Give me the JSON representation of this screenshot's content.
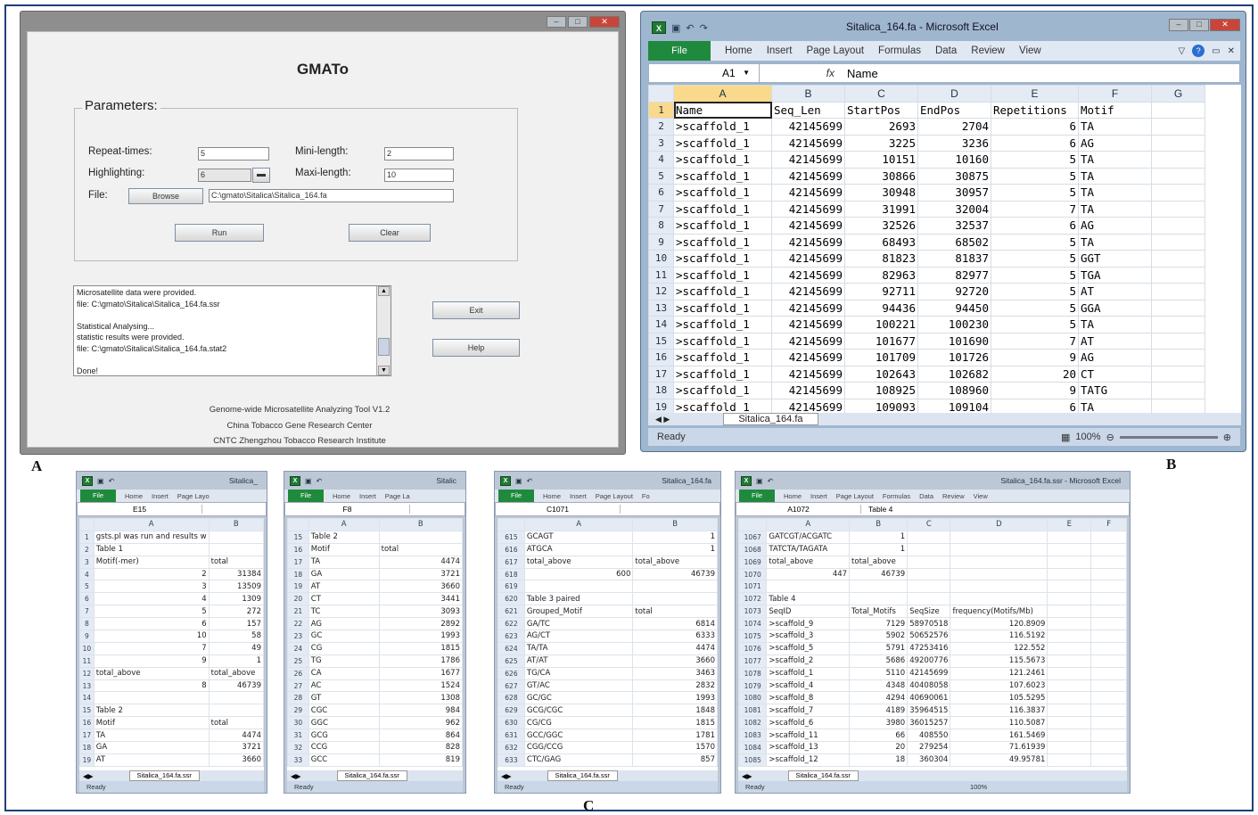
{
  "letters": {
    "a": "A",
    "b": "B",
    "c": "C"
  },
  "gmato": {
    "title": "GMATo",
    "params_legend": "Parameters:",
    "repeat_label": "Repeat-times:",
    "repeat_value": "5",
    "minilen_label": "Mini-length:",
    "minilen_value": "2",
    "highlight_label": "Highlighting:",
    "highlight_value": "6",
    "maxlen_label": "Maxi-length:",
    "maxlen_value": "10",
    "file_label": "File:",
    "browse_label": "Browse",
    "file_path": "C:\\gmato\\Sitalica\\Sitalica_164.fa",
    "run_label": "Run",
    "clear_label": "Clear",
    "log_lines": [
      "Microsatellite data were provided.",
      "file:  C:\\gmato\\Sitalica\\Sitalica_164.fa.ssr",
      "",
      "Statistical Analysing...",
      "statistic results were provided.",
      "file:  C:\\gmato\\Sitalica\\Sitalica_164.fa.stat2",
      "",
      "Done!"
    ],
    "exit_label": "Exit",
    "help_label": "Help",
    "footer": [
      "Genome-wide Microsatellite Analyzing Tool V1.2",
      "China Tobacco Gene Research Center",
      "CNTC Zhengzhou Tobacco Research Institute"
    ]
  },
  "excel": {
    "title": "Sitalica_164.fa - Microsoft Excel",
    "file_tab": "File",
    "menu": [
      "Home",
      "Insert",
      "Page Layout",
      "Formulas",
      "Data",
      "Review",
      "View"
    ],
    "name_box": "A1",
    "fx": "fx",
    "formula_value": "Name",
    "col_headers": [
      "A",
      "B",
      "C",
      "D",
      "E",
      "F",
      "G"
    ],
    "rows": [
      [
        "1",
        "Name",
        "Seq_Len",
        "StartPos",
        "EndPos",
        "Repetitions",
        "Motif"
      ],
      [
        "2",
        ">scaffold_1",
        "42145699",
        "2693",
        "2704",
        "6",
        "TA"
      ],
      [
        "3",
        ">scaffold_1",
        "42145699",
        "3225",
        "3236",
        "6",
        "AG"
      ],
      [
        "4",
        ">scaffold_1",
        "42145699",
        "10151",
        "10160",
        "5",
        "TA"
      ],
      [
        "5",
        ">scaffold_1",
        "42145699",
        "30866",
        "30875",
        "5",
        "TA"
      ],
      [
        "6",
        ">scaffold_1",
        "42145699",
        "30948",
        "30957",
        "5",
        "TA"
      ],
      [
        "7",
        ">scaffold_1",
        "42145699",
        "31991",
        "32004",
        "7",
        "TA"
      ],
      [
        "8",
        ">scaffold_1",
        "42145699",
        "32526",
        "32537",
        "6",
        "AG"
      ],
      [
        "9",
        ">scaffold_1",
        "42145699",
        "68493",
        "68502",
        "5",
        "TA"
      ],
      [
        "10",
        ">scaffold_1",
        "42145699",
        "81823",
        "81837",
        "5",
        "GGT"
      ],
      [
        "11",
        ">scaffold_1",
        "42145699",
        "82963",
        "82977",
        "5",
        "TGA"
      ],
      [
        "12",
        ">scaffold_1",
        "42145699",
        "92711",
        "92720",
        "5",
        "AT"
      ],
      [
        "13",
        ">scaffold_1",
        "42145699",
        "94436",
        "94450",
        "5",
        "GGA"
      ],
      [
        "14",
        ">scaffold_1",
        "42145699",
        "100221",
        "100230",
        "5",
        "TA"
      ],
      [
        "15",
        ">scaffold_1",
        "42145699",
        "101677",
        "101690",
        "7",
        "AT"
      ],
      [
        "16",
        ">scaffold_1",
        "42145699",
        "101709",
        "101726",
        "9",
        "AG"
      ],
      [
        "17",
        ">scaffold_1",
        "42145699",
        "102643",
        "102682",
        "20",
        "CT"
      ],
      [
        "18",
        ">scaffold_1",
        "42145699",
        "108925",
        "108960",
        "9",
        "TATG"
      ],
      [
        "19",
        ">scaffold_1",
        "42145699",
        "109093",
        "109104",
        "6",
        "TA"
      ]
    ],
    "sheet_tab": "Sitalica_164.fa",
    "status": "Ready",
    "zoom": "100%"
  },
  "small": [
    {
      "title": "Sitalica_",
      "name_box": "E15",
      "formula_value": "",
      "file_tab": "File",
      "menu": [
        "Home",
        "Insert",
        "Page Layo"
      ],
      "cols": [
        "A",
        "B"
      ],
      "rows": [
        [
          "1",
          "gsts.pl was run and results w",
          ""
        ],
        [
          "2",
          "Table 1",
          ""
        ],
        [
          "3",
          "Motif(-mer)",
          "total"
        ],
        [
          "4",
          "2",
          "31384"
        ],
        [
          "5",
          "3",
          "13509"
        ],
        [
          "6",
          "4",
          "1309"
        ],
        [
          "7",
          "5",
          "272"
        ],
        [
          "8",
          "6",
          "157"
        ],
        [
          "9",
          "10",
          "58"
        ],
        [
          "10",
          "7",
          "49"
        ],
        [
          "11",
          "9",
          "1"
        ],
        [
          "12",
          "total_above",
          "total_above"
        ],
        [
          "13",
          "8",
          "46739"
        ],
        [
          "14",
          "",
          ""
        ],
        [
          "15",
          "Table 2",
          ""
        ],
        [
          "16",
          "Motif",
          "total"
        ],
        [
          "17",
          "TA",
          "4474"
        ],
        [
          "18",
          "GA",
          "3721"
        ],
        [
          "19",
          "AT",
          "3660"
        ]
      ],
      "sheet_tab": "Sitalica_164.fa.ssr",
      "status": "Ready"
    },
    {
      "title": "Sitalic",
      "name_box": "F8",
      "formula_value": "",
      "file_tab": "File",
      "menu": [
        "Home",
        "Insert",
        "Page La"
      ],
      "cols": [
        "A",
        "B"
      ],
      "rows": [
        [
          "15",
          "Table 2",
          ""
        ],
        [
          "16",
          "Motif",
          "total"
        ],
        [
          "17",
          "TA",
          "4474"
        ],
        [
          "18",
          "GA",
          "3721"
        ],
        [
          "19",
          "AT",
          "3660"
        ],
        [
          "20",
          "CT",
          "3441"
        ],
        [
          "21",
          "TC",
          "3093"
        ],
        [
          "22",
          "AG",
          "2892"
        ],
        [
          "23",
          "GC",
          "1993"
        ],
        [
          "24",
          "CG",
          "1815"
        ],
        [
          "25",
          "TG",
          "1786"
        ],
        [
          "26",
          "CA",
          "1677"
        ],
        [
          "27",
          "AC",
          "1524"
        ],
        [
          "28",
          "GT",
          "1308"
        ],
        [
          "29",
          "CGC",
          "984"
        ],
        [
          "30",
          "GGC",
          "962"
        ],
        [
          "31",
          "GCG",
          "864"
        ],
        [
          "32",
          "CCG",
          "828"
        ],
        [
          "33",
          "GCC",
          "819"
        ]
      ],
      "sheet_tab": "Sitalica_164.fa.ssr",
      "status": "Ready"
    },
    {
      "title": "Sitalica_164.fa",
      "name_box": "C1071",
      "formula_value": "",
      "file_tab": "File",
      "menu": [
        "Home",
        "Insert",
        "Page Layout",
        "Fo"
      ],
      "cols": [
        "A",
        "B"
      ],
      "rows": [
        [
          "615",
          "GCAGT",
          "1"
        ],
        [
          "616",
          "ATGCA",
          "1"
        ],
        [
          "617",
          "total_above",
          "total_above"
        ],
        [
          "618",
          "600",
          "46739"
        ],
        [
          "619",
          "",
          ""
        ],
        [
          "620",
          "Table 3 paired",
          ""
        ],
        [
          "621",
          "Grouped_Motif",
          "total"
        ],
        [
          "622",
          "GA/TC",
          "6814"
        ],
        [
          "623",
          "AG/CT",
          "6333"
        ],
        [
          "624",
          "TA/TA",
          "4474"
        ],
        [
          "625",
          "AT/AT",
          "3660"
        ],
        [
          "626",
          "TG/CA",
          "3463"
        ],
        [
          "627",
          "GT/AC",
          "2832"
        ],
        [
          "628",
          "GC/GC",
          "1993"
        ],
        [
          "629",
          "GCG/CGC",
          "1848"
        ],
        [
          "630",
          "CG/CG",
          "1815"
        ],
        [
          "631",
          "GCC/GGC",
          "1781"
        ],
        [
          "632",
          "CGG/CCG",
          "1570"
        ],
        [
          "633",
          "CTC/GAG",
          "857"
        ]
      ],
      "sheet_tab": "Sitalica_164.fa.ssr",
      "status": "Ready"
    },
    {
      "title": "Sitalica_164.fa.ssr - Microsoft Excel",
      "name_box": "A1072",
      "formula_value": "Table 4",
      "file_tab": "File",
      "menu": [
        "Home",
        "Insert",
        "Page Layout",
        "Formulas",
        "Data",
        "Review",
        "View"
      ],
      "cols": [
        "A",
        "B",
        "C",
        "D",
        "E",
        "F"
      ],
      "rows": [
        [
          "1067",
          "GATCGT/ACGATC",
          "1",
          "",
          "",
          "",
          ""
        ],
        [
          "1068",
          "TATCTA/TAGATA",
          "1",
          "",
          "",
          "",
          ""
        ],
        [
          "1069",
          "total_above",
          "total_above",
          "",
          "",
          "",
          ""
        ],
        [
          "1070",
          "447",
          "46739",
          "",
          "",
          "",
          ""
        ],
        [
          "1071",
          "",
          "",
          "",
          "",
          "",
          ""
        ],
        [
          "1072",
          "Table 4",
          "",
          "",
          "",
          "",
          ""
        ],
        [
          "1073",
          "SeqID",
          "Total_Motifs",
          "SeqSize",
          "frequency(Motifs/Mb)",
          "",
          ""
        ],
        [
          "1074",
          ">scaffold_9",
          "7129",
          "58970518",
          "120.8909",
          "",
          ""
        ],
        [
          "1075",
          ">scaffold_3",
          "5902",
          "50652576",
          "116.5192",
          "",
          ""
        ],
        [
          "1076",
          ">scaffold_5",
          "5791",
          "47253416",
          "122.552",
          "",
          ""
        ],
        [
          "1077",
          ">scaffold_2",
          "5686",
          "49200776",
          "115.5673",
          "",
          ""
        ],
        [
          "1078",
          ">scaffold_1",
          "5110",
          "42145699",
          "121.2461",
          "",
          ""
        ],
        [
          "1079",
          ">scaffold_4",
          "4348",
          "40408058",
          "107.6023",
          "",
          ""
        ],
        [
          "1080",
          ">scaffold_8",
          "4294",
          "40690061",
          "105.5295",
          "",
          ""
        ],
        [
          "1081",
          ">scaffold_7",
          "4189",
          "35964515",
          "116.3837",
          "",
          ""
        ],
        [
          "1082",
          ">scaffold_6",
          "3980",
          "36015257",
          "110.5087",
          "",
          ""
        ],
        [
          "1083",
          ">scaffold_11",
          "66",
          "408550",
          "161.5469",
          "",
          ""
        ],
        [
          "1084",
          ">scaffold_13",
          "20",
          "279254",
          "71.61939",
          "",
          ""
        ],
        [
          "1085",
          ">scaffold_12",
          "18",
          "360304",
          "49.95781",
          "",
          ""
        ]
      ],
      "sheet_tab": "Sitalica_164.fa.ssr",
      "status": "Ready",
      "zoom": "100%"
    }
  ]
}
